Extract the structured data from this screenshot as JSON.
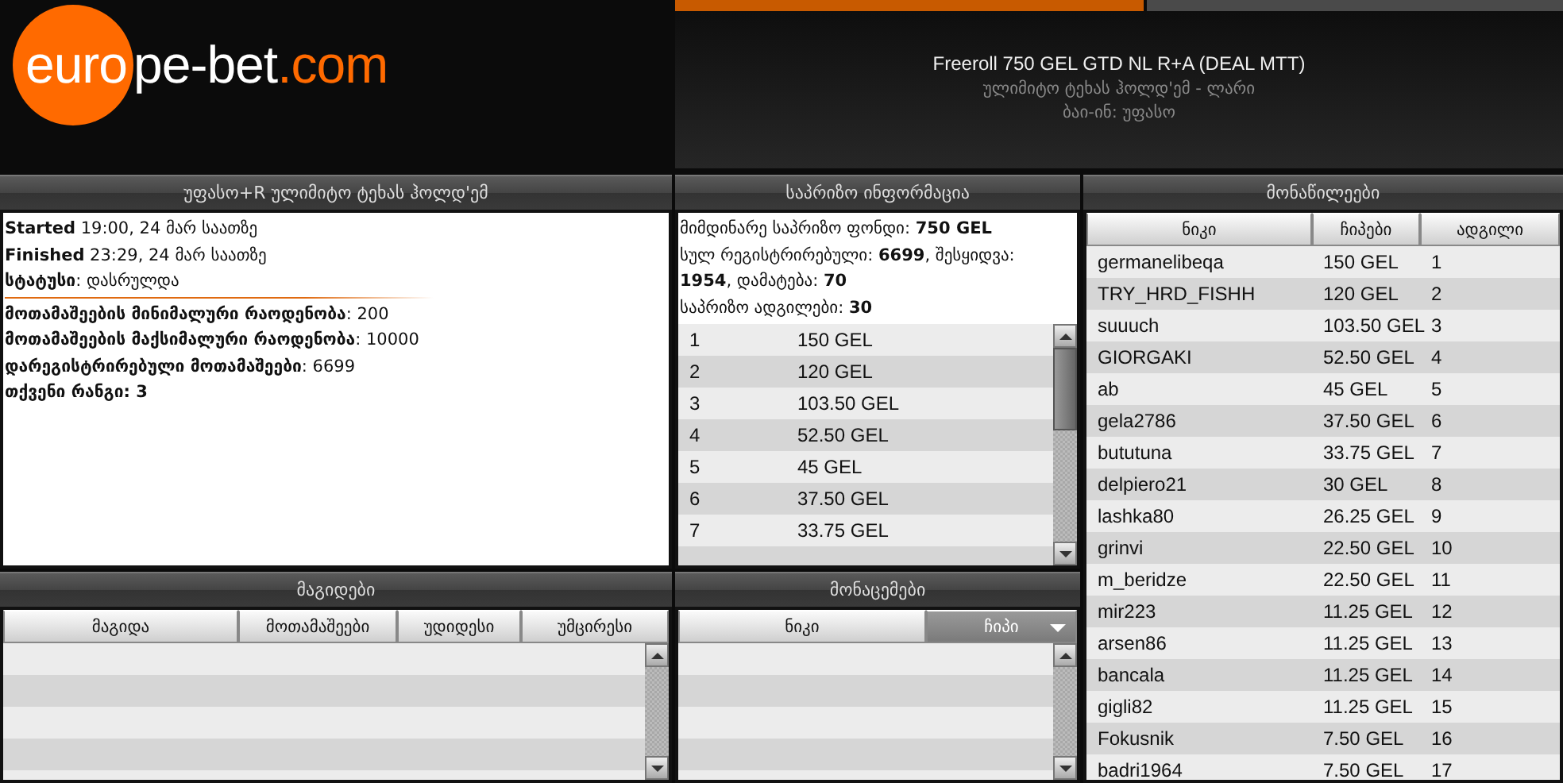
{
  "tabs": [
    {
      "selected": true
    },
    {
      "selected": false
    }
  ],
  "logo": {
    "parts": [
      {
        "text": "euro",
        "kind": "circle"
      },
      {
        "text": "pe-bet",
        "kind": "plain"
      },
      {
        "text": ".com",
        "kind": "accent"
      }
    ]
  },
  "tournament": {
    "title": "Freeroll 750 GEL GTD NL R+A (DEAL MTT)",
    "game": "ულიმიტო ტეხას ჰოლდ'ემ - ლარი",
    "buy_in": "ბაი-ინ: უფასო"
  },
  "info_panel": {
    "title": "უფასო+R ულიმიტო ტეხას ჰოლდ'ემ",
    "sections": [
      [
        "**Started** 19:00, 24 მარ საათზე",
        "**Finished** 23:29, 24 მარ საათზე",
        "**სტატუსი**: დასრულდა"
      ],
      [
        "**მოთამაშეების მინიმალური რაოდენობა**: 200",
        "**მოთამაშეების მაქსიმალური რაოდენობა**: 10000",
        "**დარეგისტრირებული მოთამაშეები**: 6699",
        "**თქვენი რანგი: 3**"
      ]
    ]
  },
  "prize_panel": {
    "title": "საპრიზო ინფორმაცია",
    "summary": [
      "მიმდინარე საპრიზო ფონდი: **750 GEL**",
      "სულ რეგისტრირებული: **6699**, შესყიდვა: **1954**, დამატება: **70**",
      "საპრიზო ადგილები: **30**"
    ],
    "rows": [
      [
        "1",
        "150 GEL"
      ],
      [
        "2",
        "120 GEL"
      ],
      [
        "3",
        "103.50 GEL"
      ],
      [
        "4",
        "52.50 GEL"
      ],
      [
        "5",
        "45 GEL"
      ],
      [
        "6",
        "37.50 GEL"
      ],
      [
        "7",
        "33.75 GEL"
      ]
    ]
  },
  "players_panel": {
    "title": "მონაწილეები",
    "columns": [
      {
        "label": "ნიკი",
        "sorted": false
      },
      {
        "label": "ჩიპები",
        "sorted": false
      },
      {
        "label": "ადგილი",
        "sorted": false
      }
    ],
    "rows": [
      [
        "germanelibeqa",
        "150 GEL",
        "1"
      ],
      [
        "TRY_HRD_FISHH",
        "120 GEL",
        "2"
      ],
      [
        "suuuch",
        "103.50 GEL",
        "3"
      ],
      [
        "GIORGAKI",
        "52.50 GEL",
        "4"
      ],
      [
        "ab",
        "45 GEL",
        "5"
      ],
      [
        "gela2786",
        "37.50 GEL",
        "6"
      ],
      [
        "bututuna",
        "33.75 GEL",
        "7"
      ],
      [
        "delpiero21",
        "30 GEL",
        "8"
      ],
      [
        "lashka80",
        "26.25 GEL",
        "9"
      ],
      [
        "grinvi",
        "22.50 GEL",
        "10"
      ],
      [
        "m_beridze",
        "22.50 GEL",
        "11"
      ],
      [
        "mir223",
        "11.25 GEL",
        "12"
      ],
      [
        "arsen86",
        "11.25 GEL",
        "13"
      ],
      [
        "bancala",
        "11.25 GEL",
        "14"
      ],
      [
        "gigli82",
        "11.25 GEL",
        "15"
      ],
      [
        "Fokusnik",
        "7.50 GEL",
        "16"
      ],
      [
        "badri1964",
        "7.50 GEL",
        "17"
      ]
    ]
  },
  "tables_panel": {
    "title": "მაგიდები",
    "columns": [
      {
        "label": "მაგიდა",
        "sorted": false
      },
      {
        "label": "მოთამაშეები",
        "sorted": false
      },
      {
        "label": "უდიდესი",
        "sorted": false
      },
      {
        "label": "უმცირესი",
        "sorted": false
      }
    ]
  },
  "observers_panel": {
    "title": "მონაცემები",
    "columns": [
      {
        "label": "ნიკი",
        "sorted": false
      },
      {
        "label": "ჩიპი",
        "sorted": true
      }
    ]
  }
}
